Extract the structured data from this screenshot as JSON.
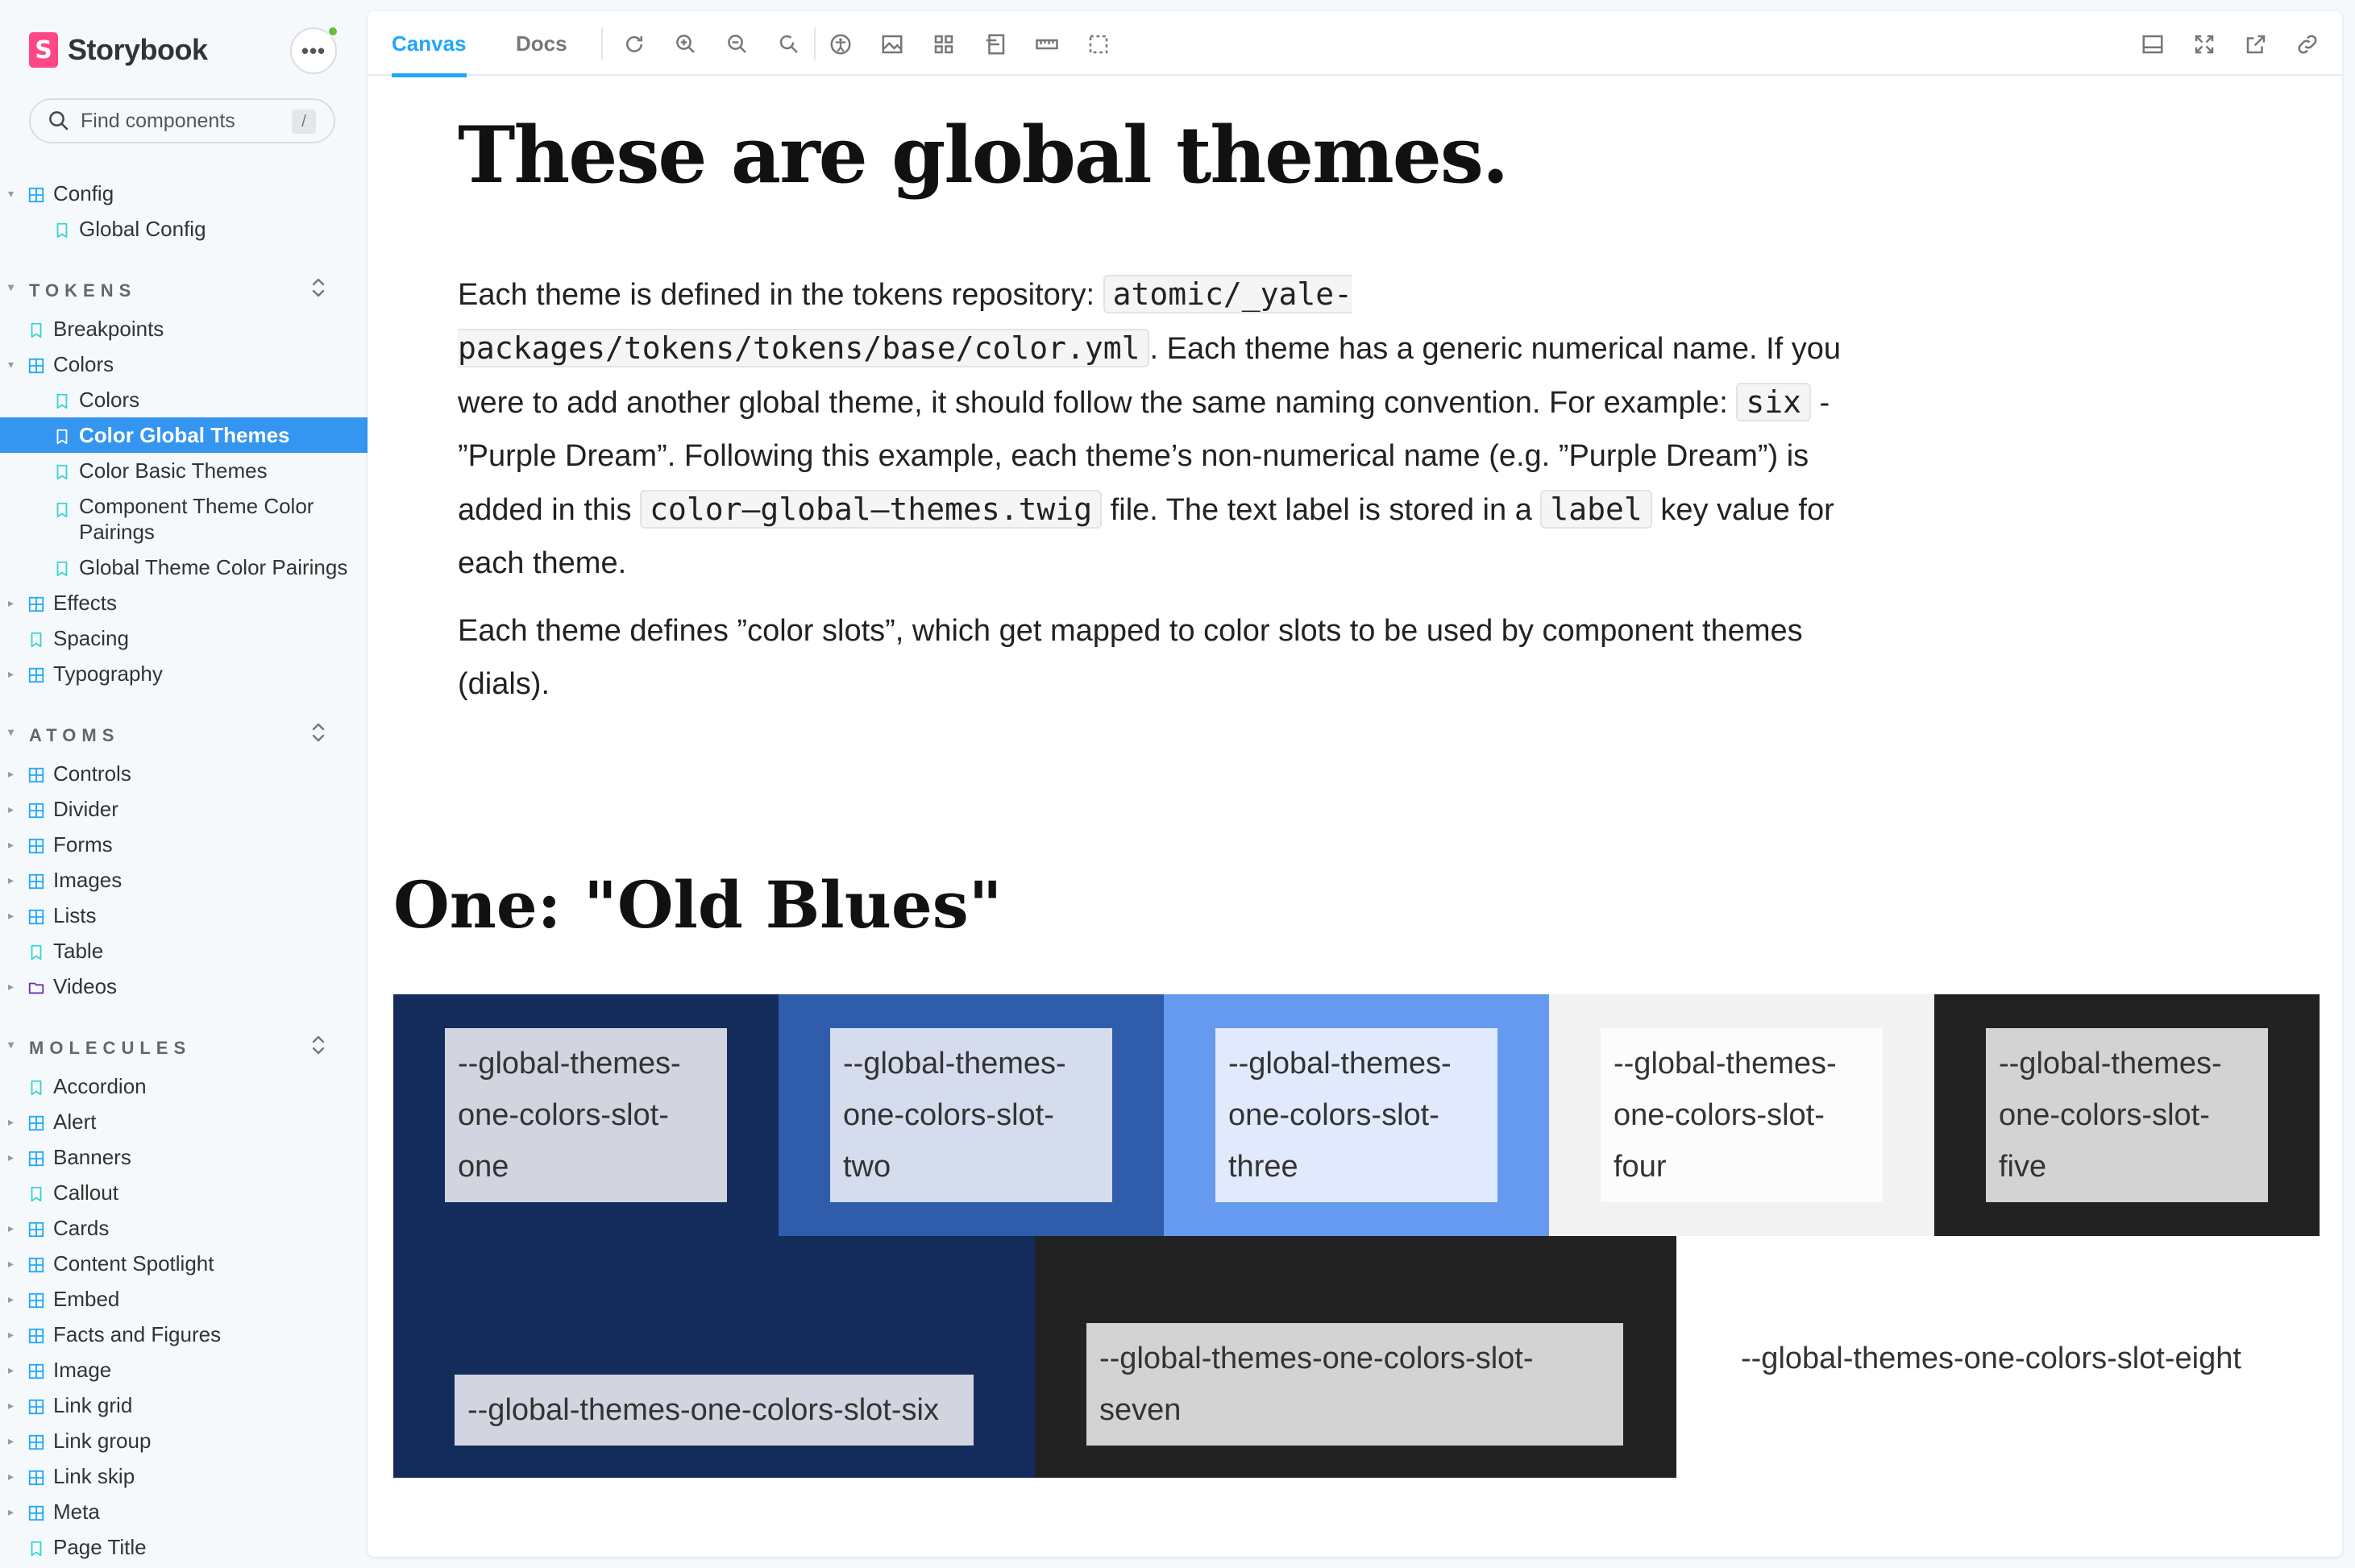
{
  "app": {
    "brand_name": "Storybook",
    "brand_mark": "S",
    "menu_label": "•••"
  },
  "search": {
    "placeholder": "Find components",
    "shortcut": "/"
  },
  "sidebar": {
    "top_items": [
      {
        "label": "Config",
        "kind": "component",
        "expanded": true
      },
      {
        "label": "Global Config",
        "kind": "story"
      }
    ],
    "sections": [
      {
        "title": "TOKENS",
        "items": [
          {
            "label": "Breakpoints",
            "kind": "story",
            "level": 1
          },
          {
            "label": "Colors",
            "kind": "component",
            "level": 1,
            "expanded": true
          },
          {
            "label": "Colors",
            "kind": "story",
            "level": 2
          },
          {
            "label": "Color Global Themes",
            "kind": "story",
            "level": 2,
            "active": true
          },
          {
            "label": "Color Basic Themes",
            "kind": "story",
            "level": 2
          },
          {
            "label": "Component Theme Color Pairings",
            "kind": "story",
            "level": 2
          },
          {
            "label": "Global Theme Color Pairings",
            "kind": "story",
            "level": 2
          },
          {
            "label": "Effects",
            "kind": "component",
            "level": 1
          },
          {
            "label": "Spacing",
            "kind": "story",
            "level": 1
          },
          {
            "label": "Typography",
            "kind": "component",
            "level": 1
          }
        ]
      },
      {
        "title": "ATOMS",
        "items": [
          {
            "label": "Controls",
            "kind": "component"
          },
          {
            "label": "Divider",
            "kind": "component"
          },
          {
            "label": "Forms",
            "kind": "component"
          },
          {
            "label": "Images",
            "kind": "component"
          },
          {
            "label": "Lists",
            "kind": "component"
          },
          {
            "label": "Table",
            "kind": "story"
          },
          {
            "label": "Videos",
            "kind": "folder"
          }
        ]
      },
      {
        "title": "MOLECULES",
        "items": [
          {
            "label": "Accordion",
            "kind": "story"
          },
          {
            "label": "Alert",
            "kind": "component"
          },
          {
            "label": "Banners",
            "kind": "component"
          },
          {
            "label": "Callout",
            "kind": "story"
          },
          {
            "label": "Cards",
            "kind": "component"
          },
          {
            "label": "Content Spotlight",
            "kind": "component"
          },
          {
            "label": "Embed",
            "kind": "component"
          },
          {
            "label": "Facts and Figures",
            "kind": "component"
          },
          {
            "label": "Image",
            "kind": "component"
          },
          {
            "label": "Link grid",
            "kind": "component"
          },
          {
            "label": "Link group",
            "kind": "component"
          },
          {
            "label": "Link skip",
            "kind": "component"
          },
          {
            "label": "Meta",
            "kind": "component"
          },
          {
            "label": "Page Title",
            "kind": "story"
          }
        ]
      }
    ]
  },
  "toolbar": {
    "tab_canvas": "Canvas",
    "tab_docs": "Docs",
    "tools": [
      "reload-icon",
      "zoom-in-icon",
      "zoom-out-icon",
      "zoom-reset-icon",
      "accessibility-icon",
      "background-icon",
      "grid-icon",
      "viewport-icon",
      "measure-icon",
      "outline-icon"
    ],
    "right_tools": [
      "panel-icon",
      "fullscreen-icon",
      "new-tab-icon",
      "copy-link-icon"
    ]
  },
  "doc": {
    "title": "These are global themes.",
    "p1_a": "Each theme is defined in the tokens repository: ",
    "p1_code1": "atomic/_yale-packages/tokens/tokens/base/color.yml",
    "p1_b": ". Each theme has a generic numerical name. If you were to add another global theme, it should follow the same naming convention. For example: ",
    "p1_code2": "six",
    "p1_c": " - ”Purple Dream”. Following this example, each theme’s non-numerical name (e.g. ”Purple Dream”) is added in this ",
    "p1_code3": "color—global—themes.twig",
    "p1_d": " file. The text label is stored in a ",
    "p1_code4": "label",
    "p1_e": " key value for each theme.",
    "p2": "Each theme defines ”color slots”, which get mapped to color slots to be used by component themes (dials).",
    "section_title": "One: \"Old Blues\""
  },
  "swatches": [
    {
      "label": "--global-themes-one-colors-slot-one",
      "bg": "#142c5c",
      "chip": "#d2d5df"
    },
    {
      "label": "--global-themes-one-colors-slot-two",
      "bg": "#2f5dab",
      "chip": "#d5dced"
    },
    {
      "label": "--global-themes-one-colors-slot-three",
      "bg": "#6699f0",
      "chip": "#e0eafc"
    },
    {
      "label": "--global-themes-one-colors-slot-four",
      "bg": "#f2f2f2",
      "chip": "#fcfcfc"
    },
    {
      "label": "--global-themes-one-colors-slot-five",
      "bg": "#222222",
      "chip": "#d3d3d3"
    },
    {
      "label": "--global-themes-one-colors-slot-six",
      "bg": "#142c5c",
      "chip": "#d2d5df"
    },
    {
      "label": "--global-themes-one-colors-slot-seven",
      "bg": "#222222",
      "chip": "#d3d3d3"
    },
    {
      "label": "--global-themes-one-colors-slot-eight",
      "bg": "#ffffff",
      "chip": "#ffffff"
    }
  ],
  "colors": {
    "accent": "#1ea7fd",
    "active_item": "#3596f1",
    "brand": "#ff4785",
    "status_dot": "#66bf3c"
  }
}
